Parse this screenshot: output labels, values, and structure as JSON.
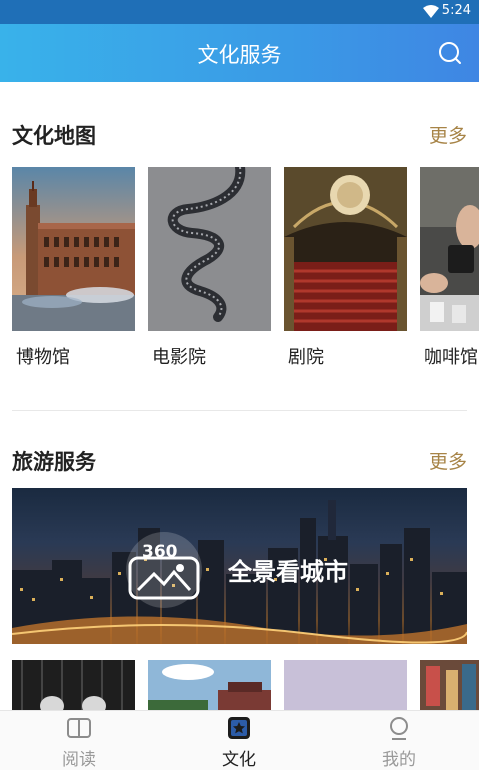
{
  "status_bar": {
    "time": "5:24"
  },
  "app_bar": {
    "title": "文化服务"
  },
  "culture_map": {
    "title": "文化地图",
    "more": "更多",
    "items": [
      {
        "label": "博物馆"
      },
      {
        "label": "电影院"
      },
      {
        "label": "剧院"
      },
      {
        "label": "咖啡馆"
      }
    ]
  },
  "travel_service": {
    "title": "旅游服务",
    "more": "更多",
    "banner": {
      "badge": "360",
      "label": "全景看城市"
    }
  },
  "tab_bar": {
    "tabs": [
      {
        "label": "阅读",
        "active": false
      },
      {
        "label": "文化",
        "active": true
      },
      {
        "label": "我的",
        "active": false
      }
    ]
  },
  "colors": {
    "accent": "#3a9ae6",
    "more_link": "#a78447",
    "active_tab_icon": "#2c5ca8"
  }
}
